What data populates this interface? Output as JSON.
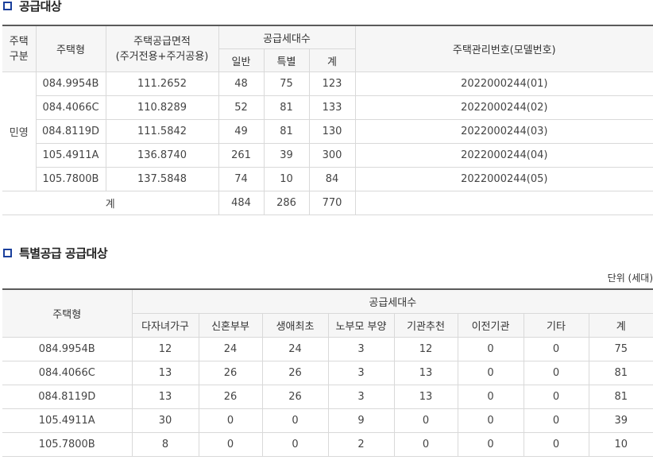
{
  "section1": {
    "title": "공급대상",
    "headers": {
      "type_group_1": "주택",
      "type_group_2": "구분",
      "house_type": "주택형",
      "area_1": "주택공급면적",
      "area_2": "(주거전용+주거공용)",
      "supply_units": "공급세대수",
      "general": "일반",
      "special": "특별",
      "total": "계",
      "mgmt_no": "주택관리번호(모델번호)"
    },
    "group_label": "민영",
    "rows": [
      {
        "type": "084.9954B",
        "area": "111.2652",
        "general": "48",
        "special": "75",
        "total": "123",
        "mgmt": "2022000244(01)"
      },
      {
        "type": "084.4066C",
        "area": "110.8289",
        "general": "52",
        "special": "81",
        "total": "133",
        "mgmt": "2022000244(02)"
      },
      {
        "type": "084.8119D",
        "area": "111.5842",
        "general": "49",
        "special": "81",
        "total": "130",
        "mgmt": "2022000244(03)"
      },
      {
        "type": "105.4911A",
        "area": "136.8740",
        "general": "261",
        "special": "39",
        "total": "300",
        "mgmt": "2022000244(04)"
      },
      {
        "type": "105.7800B",
        "area": "137.5848",
        "general": "74",
        "special": "10",
        "total": "84",
        "mgmt": "2022000244(05)"
      }
    ],
    "sum": {
      "label": "계",
      "general": "484",
      "special": "286",
      "total": "770"
    }
  },
  "section2": {
    "title": "특별공급 공급대상",
    "unit": "단위 (세대)",
    "headers": {
      "house_type": "주택형",
      "supply_units": "공급세대수",
      "cols": [
        "다자녀가구",
        "신혼부부",
        "생애최초",
        "노부모 부양",
        "기관추천",
        "이전기관",
        "기타",
        "계"
      ]
    },
    "rows": [
      {
        "type": "084.9954B",
        "vals": [
          "12",
          "24",
          "24",
          "3",
          "12",
          "0",
          "0",
          "75"
        ]
      },
      {
        "type": "084.4066C",
        "vals": [
          "13",
          "26",
          "26",
          "3",
          "13",
          "0",
          "0",
          "81"
        ]
      },
      {
        "type": "084.8119D",
        "vals": [
          "13",
          "26",
          "26",
          "3",
          "13",
          "0",
          "0",
          "81"
        ]
      },
      {
        "type": "105.4911A",
        "vals": [
          "30",
          "0",
          "0",
          "9",
          "0",
          "0",
          "0",
          "39"
        ]
      },
      {
        "type": "105.7800B",
        "vals": [
          "8",
          "0",
          "0",
          "2",
          "0",
          "0",
          "0",
          "10"
        ]
      }
    ]
  },
  "colors": {
    "accent": "#1a3f9c",
    "header_bg": "#f6f6f6",
    "border": "#d9d9d9"
  },
  "icons": [
    "square-bullet-icon"
  ]
}
